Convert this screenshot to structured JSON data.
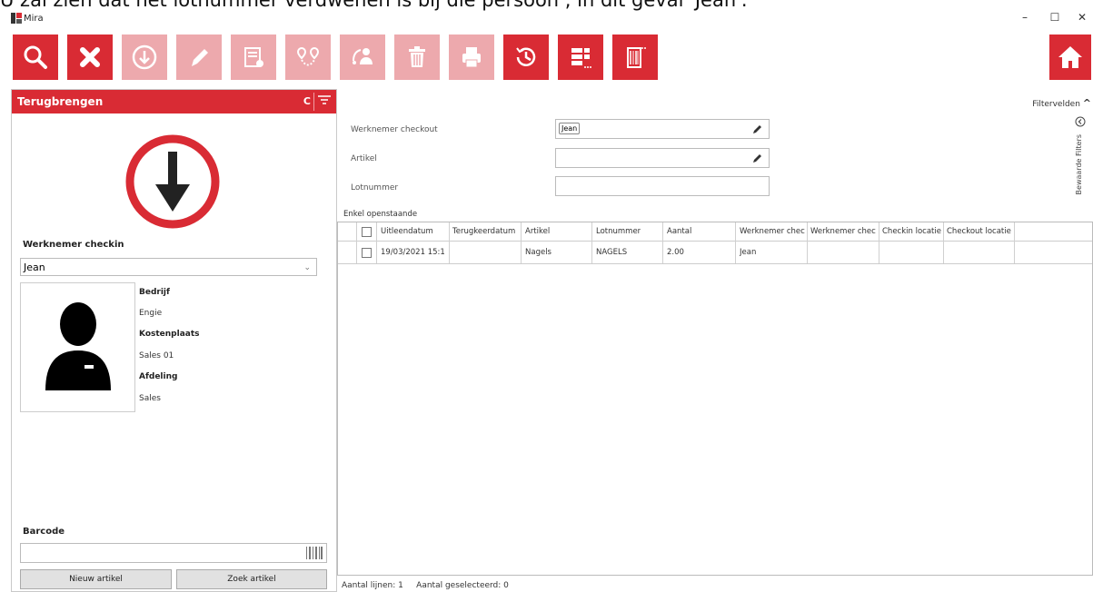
{
  "caption": "U zal zien dat het lotnummer verdwenen is bij die persoon , in dit geval 'Jean'.",
  "window": {
    "title": "Mira",
    "controls": [
      "–",
      "☐",
      "✕"
    ]
  },
  "toolbar": {
    "buttons": [
      {
        "icon": "search-icon",
        "enabled": true
      },
      {
        "icon": "close-icon",
        "enabled": true
      },
      {
        "icon": "download-circle-icon",
        "enabled": false
      },
      {
        "icon": "pencil-icon",
        "enabled": false
      },
      {
        "icon": "document-settings-icon",
        "enabled": false
      },
      {
        "icon": "route-pins-icon",
        "enabled": false
      },
      {
        "icon": "user-transfer-icon",
        "enabled": false
      },
      {
        "icon": "trash-icon",
        "enabled": false
      },
      {
        "icon": "printer-icon",
        "enabled": false
      },
      {
        "icon": "history-icon",
        "enabled": true
      },
      {
        "icon": "columns-select-icon",
        "enabled": true
      },
      {
        "icon": "barcode-grid-icon",
        "enabled": true
      },
      {
        "icon": "home-icon",
        "enabled": true
      }
    ],
    "colors": {
      "active": "#d92b34",
      "disabled": "#eda9ad"
    }
  },
  "left": {
    "header": "Terugbrengen",
    "header_c": "C",
    "employee_label": "Werknemer checkin",
    "employee_value": "Jean",
    "info": {
      "company_label": "Bedrijf",
      "company": "Engie",
      "cost_label": "Kostenplaats",
      "cost": "Sales 01",
      "dept_label": "Afdeling",
      "dept": "Sales"
    },
    "barcode_label": "Barcode",
    "barcode_value": "",
    "btn_new": "Nieuw artikel",
    "btn_search": "Zoek artikel"
  },
  "filters": {
    "toggle_label": "Filtervelden",
    "saved_filters": "Bewaarde Filters",
    "f1_label": "Werknemer checkout",
    "f1_value": "Jean",
    "f2_label": "Artikel",
    "f3_label": "Lotnummer"
  },
  "grid": {
    "caption": "Enkel openstaande",
    "columns": [
      "Uitleendatum",
      "Terugkeerdatum",
      "Artikel",
      "Lotnummer",
      "Aantal",
      "Werknemer chec",
      "Werknemer chec",
      "Checkin locatie",
      "Checkout locatie"
    ],
    "rows": [
      [
        "19/03/2021 15:1",
        "",
        "Nagels",
        "NAGELS",
        "2.00",
        "Jean",
        "",
        "",
        ""
      ]
    ]
  },
  "status": {
    "lines": "Aantal lijnen:  1",
    "selected": "Aantal geselecteerd:  0"
  }
}
